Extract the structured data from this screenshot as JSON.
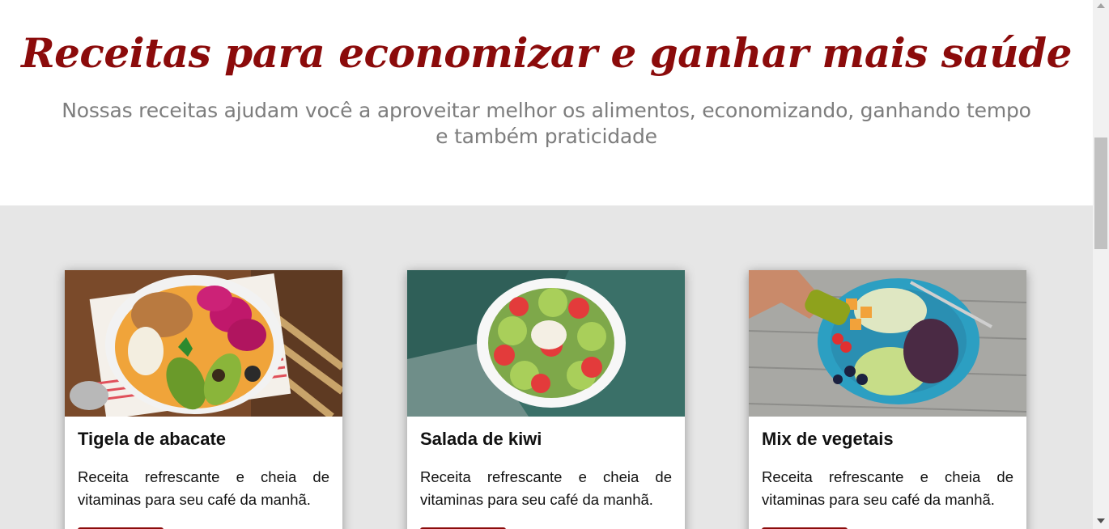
{
  "hero": {
    "title": "Receitas para economizar e ganhar mais saúde",
    "subtitle": "Nossas receitas ajudam você a aproveitar melhor os alimentos, economizando, ganhando tempo e também praticidade"
  },
  "colors": {
    "accent": "#8b0b0b",
    "section_bg": "#e6e6e6",
    "subtitle_text": "#7d7d7d"
  },
  "cards": [
    {
      "image": "avocado-bowl-photo",
      "title": "Tigela de abacate",
      "description": "Receita refrescante e cheia de vitaminas para seu café da manhã."
    },
    {
      "image": "kiwi-salad-photo",
      "title": "Salada de kiwi",
      "description": "Receita refrescante e cheia de vitaminas para seu café da manhã."
    },
    {
      "image": "vegetable-mix-photo",
      "title": "Mix de vegetais",
      "description": "Receita refrescante e cheia de vitaminas para seu café da manhã."
    }
  ]
}
